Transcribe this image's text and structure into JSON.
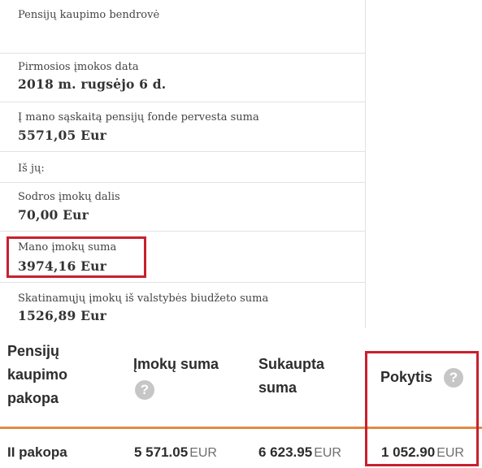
{
  "info": {
    "bendrove_label": "Pensijų kaupimo bendrovė",
    "first_payment_label": "Pirmosios įmokos data",
    "first_payment_value": "2018 m. rugsėjo 6 d.",
    "transferred_label": "Į mano sąskaitą pensijų fonde pervesta suma",
    "transferred_value": "5571,05 Eur",
    "of_which_label": "Iš jų:",
    "sodra_label": "Sodros įmokų dalis",
    "sodra_value": "70,00 Eur",
    "my_contrib_label": "Mano įmokų suma",
    "my_contrib_value": "3974,16 Eur",
    "state_label": "Skatinamųjų įmokų iš valstybės biudžeto suma",
    "state_value": "1526,89 Eur"
  },
  "table": {
    "headers": {
      "pakopa": [
        "Pensijų",
        "kaupimo",
        "pakopa"
      ],
      "imoku": "Įmokų suma",
      "sukaupta": [
        "Sukaupta",
        "suma"
      ],
      "pokytis": "Pokytis"
    },
    "help_glyph": "?",
    "row": {
      "pakopa": "II pakopa",
      "imoku": "5 571.05",
      "sukaupta": "6 623.95",
      "pokytis": "1 052.90",
      "unit": "EUR"
    }
  },
  "colors": {
    "highlight": "#c8202e",
    "divider": "#e08a45"
  }
}
